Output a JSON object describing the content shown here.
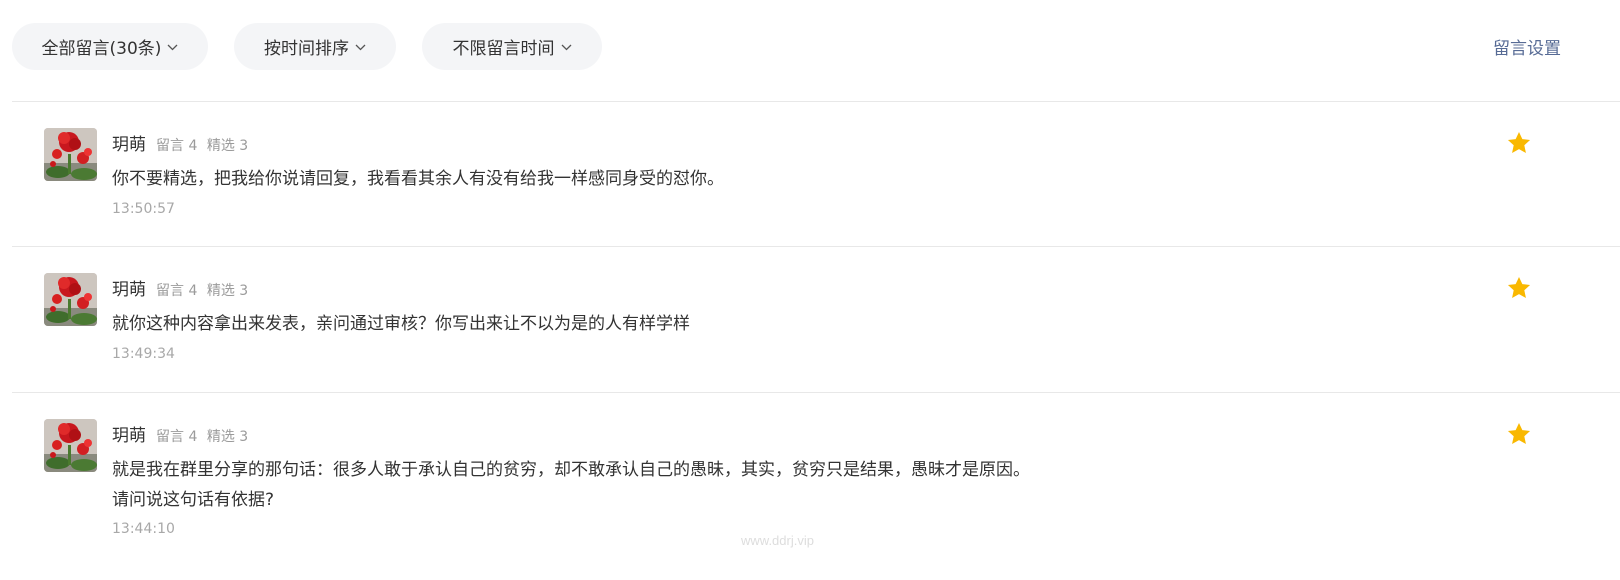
{
  "filters": {
    "all": "全部留言(30条)",
    "sort": "按时间排序",
    "time_range": "不限留言时间"
  },
  "settings_link": "留言设置",
  "comments": [
    {
      "name": "玥萌",
      "meta_count_label": "留言",
      "meta_count": "4",
      "meta_featured_label": "精选",
      "meta_featured": "3",
      "text_lines": [
        "你不要精选，把我给你说请回复，我看看其余人有没有给我一样感同身受的怼你。"
      ],
      "time": "13:50:57",
      "starred": true
    },
    {
      "name": "玥萌",
      "meta_count_label": "留言",
      "meta_count": "4",
      "meta_featured_label": "精选",
      "meta_featured": "3",
      "text_lines": [
        "就你这种内容拿出来发表，亲问通过审核？你写出来让不以为是的人有样学样"
      ],
      "time": "13:49:34",
      "starred": true
    },
    {
      "name": "玥萌",
      "meta_count_label": "留言",
      "meta_count": "4",
      "meta_featured_label": "精选",
      "meta_featured": "3",
      "text_lines": [
        "就是我在群里分享的那句话：很多人敢于承认自己的贫穷，却不敢承认自己的愚昧，其实，贫穷只是结果，愚昧才是原因。",
        "请问说这句话有依据?"
      ],
      "time": "13:44:10",
      "starred": true
    }
  ],
  "watermark": "www.ddrj.vip",
  "colors": {
    "star": "#f9b800",
    "link": "#576b95",
    "pill_bg": "#f4f5f7",
    "meta": "#9b9b9b"
  },
  "icons": {
    "chevron": "chevron-down-icon",
    "star": "star-icon",
    "avatar": "red-flower-avatar"
  }
}
